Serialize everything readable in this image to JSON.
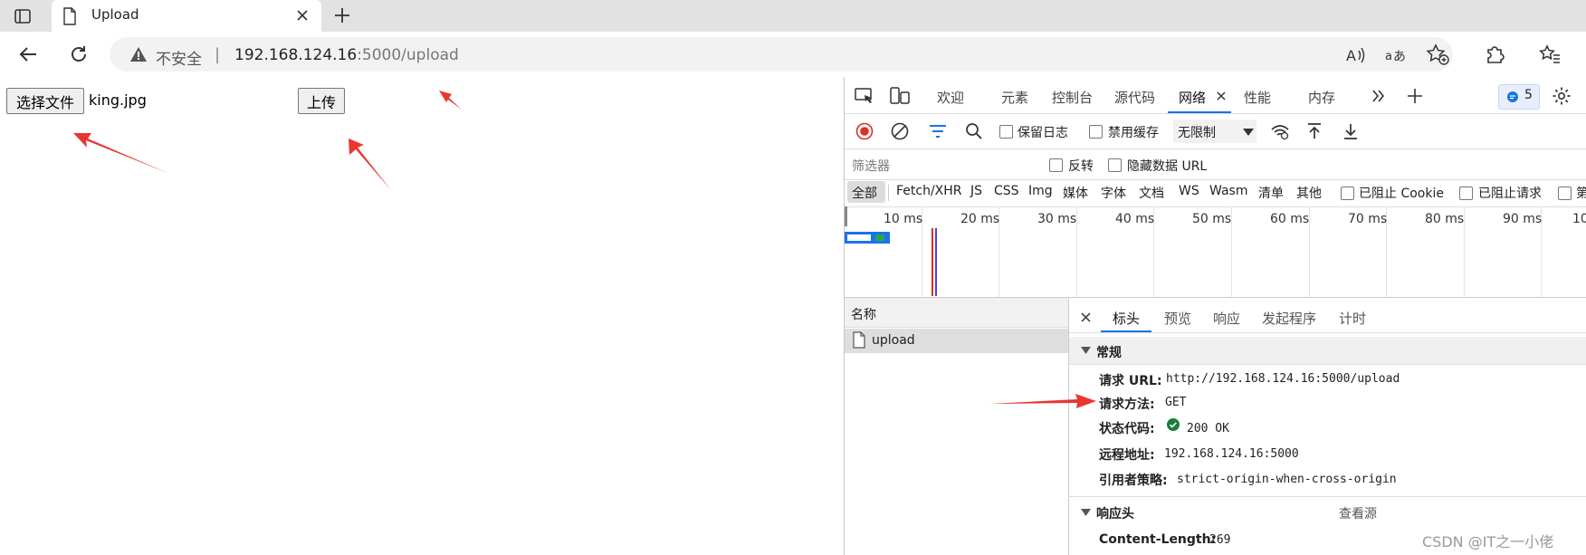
{
  "browser": {
    "tab": {
      "title": "Upload"
    },
    "address": {
      "insecure_label": "不安全",
      "separator": "|",
      "host": "192.168.124.16",
      "path": ":5000/upload"
    },
    "icons": {
      "sidebar": "sidebar-icon",
      "page": "page-icon",
      "close": "close-icon",
      "new_tab": "plus-icon",
      "back": "back-arrow-icon",
      "refresh": "refresh-icon",
      "warning": "warning-icon",
      "read_aloud": "read-aloud-icon",
      "translate": "translate-icon",
      "favorite": "star-plus-icon",
      "extensions": "puzzle-icon",
      "favorites": "favorites-icon"
    }
  },
  "page": {
    "choose_file_label": "选择文件",
    "file_name": "king.jpg",
    "upload_label": "上传"
  },
  "devtools": {
    "tabs": [
      "欢迎",
      "元素",
      "控制台",
      "源代码",
      "网络",
      "性能",
      "内存"
    ],
    "active_tab": "网络",
    "issues_count": "5",
    "toolbar": {
      "preserve_log": "保留日志",
      "disable_cache": "禁用缓存",
      "throttling": "无限制"
    },
    "filter": {
      "placeholder": "筛选器",
      "invert": "反转",
      "hide_data_urls": "隐藏数据 URL"
    },
    "types": [
      "全部",
      "Fetch/XHR",
      "JS",
      "CSS",
      "Img",
      "媒体",
      "字体",
      "文档",
      "WS",
      "Wasm",
      "清单",
      "其他"
    ],
    "blocked_cookies": "已阻止 Cookie",
    "blocked_requests": "已阻止请求",
    "third_party": "第",
    "timeline_ticks": [
      "10 ms",
      "20 ms",
      "30 ms",
      "40 ms",
      "50 ms",
      "60 ms",
      "70 ms",
      "80 ms",
      "90 ms",
      "10"
    ],
    "name_header": "名称",
    "requests": [
      {
        "name": "upload"
      }
    ],
    "detail_tabs": [
      "标头",
      "预览",
      "响应",
      "发起程序",
      "计时"
    ],
    "active_detail_tab": "标头",
    "general": {
      "title": "常规",
      "rows": [
        {
          "key": "请求 URL:",
          "value": "http://192.168.124.16:5000/upload"
        },
        {
          "key": "请求方法:",
          "value": "GET"
        },
        {
          "key": "状态代码:",
          "value": "200 OK"
        },
        {
          "key": "远程地址:",
          "value": "192.168.124.16:5000"
        },
        {
          "key": "引用者策略:",
          "value": "strict-origin-when-cross-origin"
        }
      ]
    },
    "response_headers": {
      "title": "响应头",
      "view_source": "查看源",
      "rows": [
        {
          "key": "Content-Length:",
          "value": "269"
        }
      ]
    }
  },
  "watermark": "CSDN @IT之一小佬",
  "colors": {
    "accent": "#1a73e8",
    "record_red": "#d93025",
    "status_ok": "#188038",
    "annotation_arrow": "#e8372f"
  }
}
